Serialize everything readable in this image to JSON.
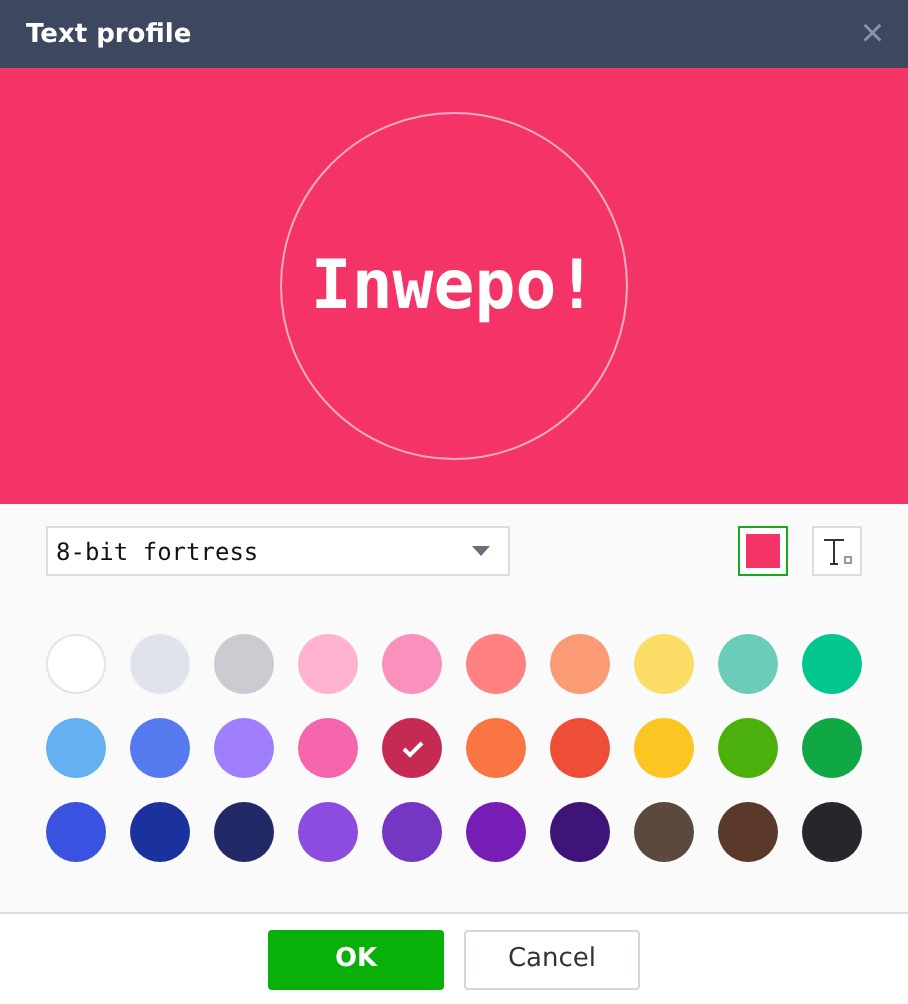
{
  "window": {
    "title": "Text profile",
    "close": "×"
  },
  "preview": {
    "text": "Inwepo!"
  },
  "font_select": {
    "value": "8-bit fortress"
  },
  "swatches": [
    {
      "color": "#ffffff",
      "selected": false
    },
    {
      "color": "#e0e3ea",
      "selected": false
    },
    {
      "color": "#cbccd1",
      "selected": false
    },
    {
      "color": "#ffb1d0",
      "selected": false
    },
    {
      "color": "#f991bc",
      "selected": false
    },
    {
      "color": "#ff8182",
      "selected": false
    },
    {
      "color": "#fb9b75",
      "selected": false
    },
    {
      "color": "#fbdc65",
      "selected": false
    },
    {
      "color": "#6bccb8",
      "selected": false
    },
    {
      "color": "#02c68c",
      "selected": false
    },
    {
      "color": "#64b0f0",
      "selected": false
    },
    {
      "color": "#5579ef",
      "selected": false
    },
    {
      "color": "#9f7ffe",
      "selected": false
    },
    {
      "color": "#f566ad",
      "selected": false
    },
    {
      "color": "#c42a52",
      "selected": true
    },
    {
      "color": "#f97544",
      "selected": false
    },
    {
      "color": "#ee4d37",
      "selected": false
    },
    {
      "color": "#fbc522",
      "selected": false
    },
    {
      "color": "#4cb00c",
      "selected": false
    },
    {
      "color": "#0fa844",
      "selected": false
    },
    {
      "color": "#3a52e0",
      "selected": false
    },
    {
      "color": "#1a319e",
      "selected": false
    },
    {
      "color": "#212a67",
      "selected": false
    },
    {
      "color": "#8c4ce0",
      "selected": false
    },
    {
      "color": "#7436c3",
      "selected": false
    },
    {
      "color": "#771cb5",
      "selected": false
    },
    {
      "color": "#3f1478",
      "selected": false
    },
    {
      "color": "#5b493e",
      "selected": false
    },
    {
      "color": "#5a392a",
      "selected": false
    },
    {
      "color": "#25272b",
      "selected": false
    }
  ],
  "buttons": [
    {
      "label": "OK",
      "kind": "primary"
    },
    {
      "label": "Cancel",
      "kind": "secondary"
    }
  ]
}
